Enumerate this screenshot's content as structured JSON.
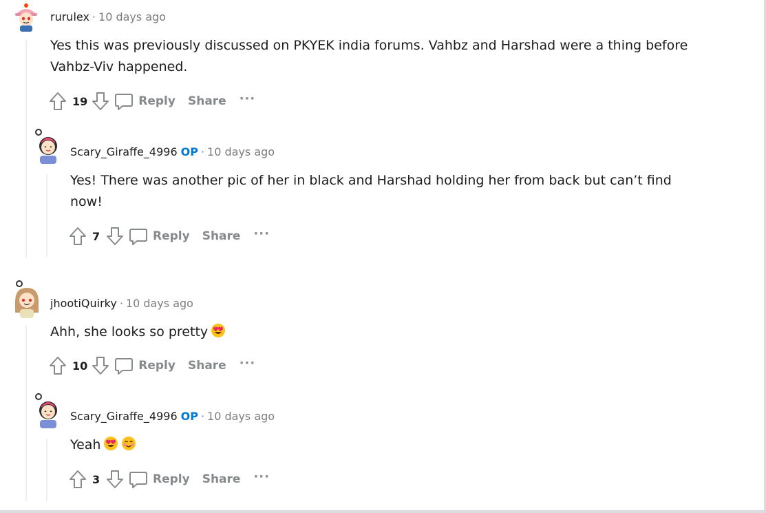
{
  "comments": [
    {
      "author": "rurulex",
      "is_op": false,
      "time": "10 days ago",
      "body": [
        "Yes this was previously discussed on PKYEK india forums. Vahbz and Harshad were a thing before",
        "Vahbz-Viv happened."
      ],
      "votes": "19",
      "reply_label": "Reply",
      "share_label": "Share",
      "avatar": "girl-avatar-pink-hat"
    },
    {
      "author": "Scary_Giraffe_4996",
      "is_op": true,
      "op_label": "OP",
      "time": "10 days ago",
      "body": [
        "Yes! There was another pic of her in black and Harshad holding her from back but can’t find",
        "now!"
      ],
      "votes": "7",
      "reply_label": "Reply",
      "share_label": "Share",
      "avatar": "girl-avatar-black-hair"
    },
    {
      "author": "jhootiQuirky",
      "is_op": false,
      "time": "10 days ago",
      "body": [
        "Ahh, she looks so pretty"
      ],
      "emojis": [
        "heart-eyes-emoji"
      ],
      "votes": "10",
      "reply_label": "Reply",
      "share_label": "Share",
      "avatar": "girl-avatar-brown-hair"
    },
    {
      "author": "Scary_Giraffe_4996",
      "is_op": true,
      "op_label": "OP",
      "time": "10 days ago",
      "body": [
        "Yeah"
      ],
      "emojis": [
        "heart-eyes-emoji",
        "smiling-blush-emoji"
      ],
      "votes": "3",
      "reply_label": "Reply",
      "share_label": "Share",
      "avatar": "girl-avatar-black-hair"
    }
  ],
  "separator": "·",
  "more_label": "···",
  "colors": {
    "op": "#0079d3",
    "muted": "#878a8c",
    "thread_line": "#edeff1"
  }
}
